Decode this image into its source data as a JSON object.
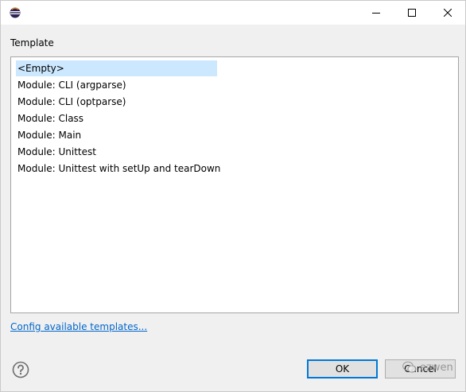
{
  "titlebar": {
    "app_icon": "eclipse-icon",
    "controls": [
      "minimize-icon",
      "maximize-icon",
      "close-icon"
    ]
  },
  "template_section": {
    "label": "Template",
    "items": [
      {
        "label": "<Empty>",
        "selected": true
      },
      {
        "label": "Module: CLI (argparse)",
        "selected": false
      },
      {
        "label": "Module: CLI (optparse)",
        "selected": false
      },
      {
        "label": "Module: Class",
        "selected": false
      },
      {
        "label": "Module: Main",
        "selected": false
      },
      {
        "label": "Module: Unittest",
        "selected": false
      },
      {
        "label": "Module: Unittest with setUp and tearDown",
        "selected": false
      }
    ]
  },
  "config_link": "Config available templates...",
  "footer": {
    "help_icon": "help-icon",
    "ok_label": "OK",
    "cancel_label": "Cancel"
  },
  "watermark": {
    "text": "ezwen",
    "icon": "wechat-icon"
  },
  "colors": {
    "selection": "#cce8ff",
    "link": "#0066cc",
    "focus_border": "#0078d7",
    "dialog_bg": "#f0f0f0"
  }
}
